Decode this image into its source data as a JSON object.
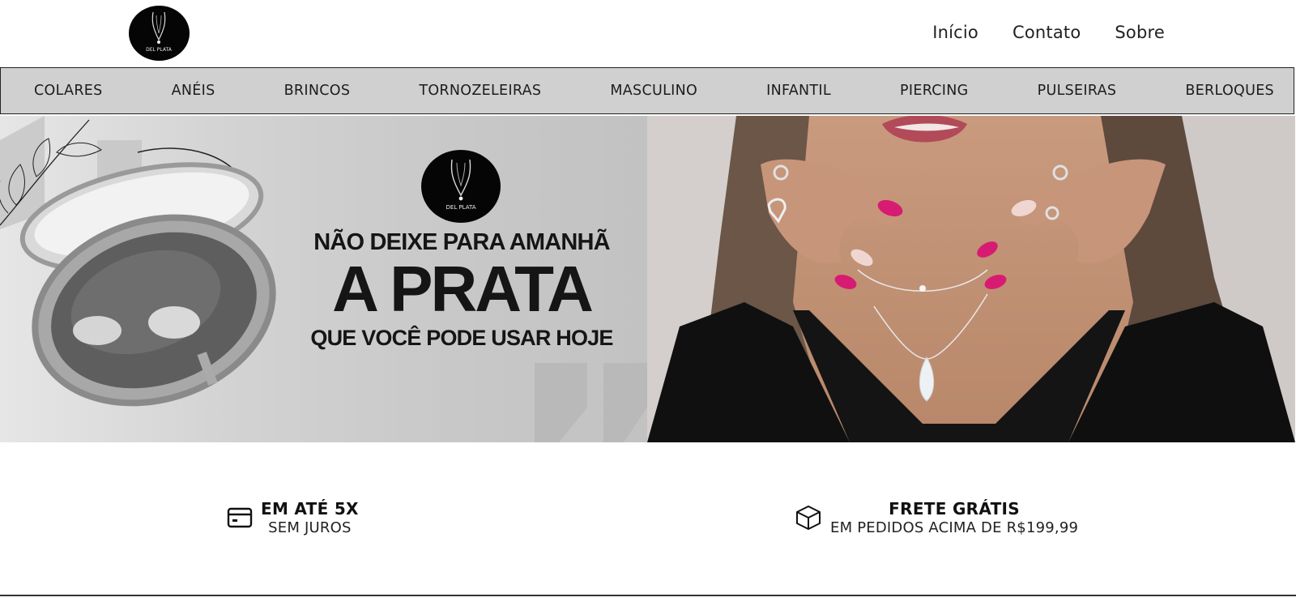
{
  "header": {
    "logo_text": "DEL PLATA",
    "nav": [
      {
        "label": "Início"
      },
      {
        "label": "Contato"
      },
      {
        "label": "Sobre"
      }
    ]
  },
  "categories": [
    {
      "label": "COLARES"
    },
    {
      "label": "ANÉIS"
    },
    {
      "label": "BRINCOS"
    },
    {
      "label": "TORNOZELEIRAS"
    },
    {
      "label": "MASCULINO"
    },
    {
      "label": "INFANTIL"
    },
    {
      "label": "PIERCING"
    },
    {
      "label": "PULSEIRAS"
    },
    {
      "label": "BERLOQUES"
    }
  ],
  "hero": {
    "line1": "NÃO DEIXE PARA AMANHÃ",
    "line2": "A PRATA",
    "line3": "QUE VOCÊ PODE USAR HOJE",
    "logo_text": "DEL PLATA"
  },
  "features": [
    {
      "icon": "credit-card-icon",
      "title": "EM ATÉ 5X",
      "subtitle": "SEM JUROS"
    },
    {
      "icon": "box-icon",
      "title": "FRETE GRÁTIS",
      "subtitle": "EM PEDIDOS ACIMA DE R$199,99"
    }
  ],
  "colors": {
    "category_bar": "#d0d0d0",
    "logo_bg": "#050505",
    "nail_accent": "#d81b72"
  }
}
